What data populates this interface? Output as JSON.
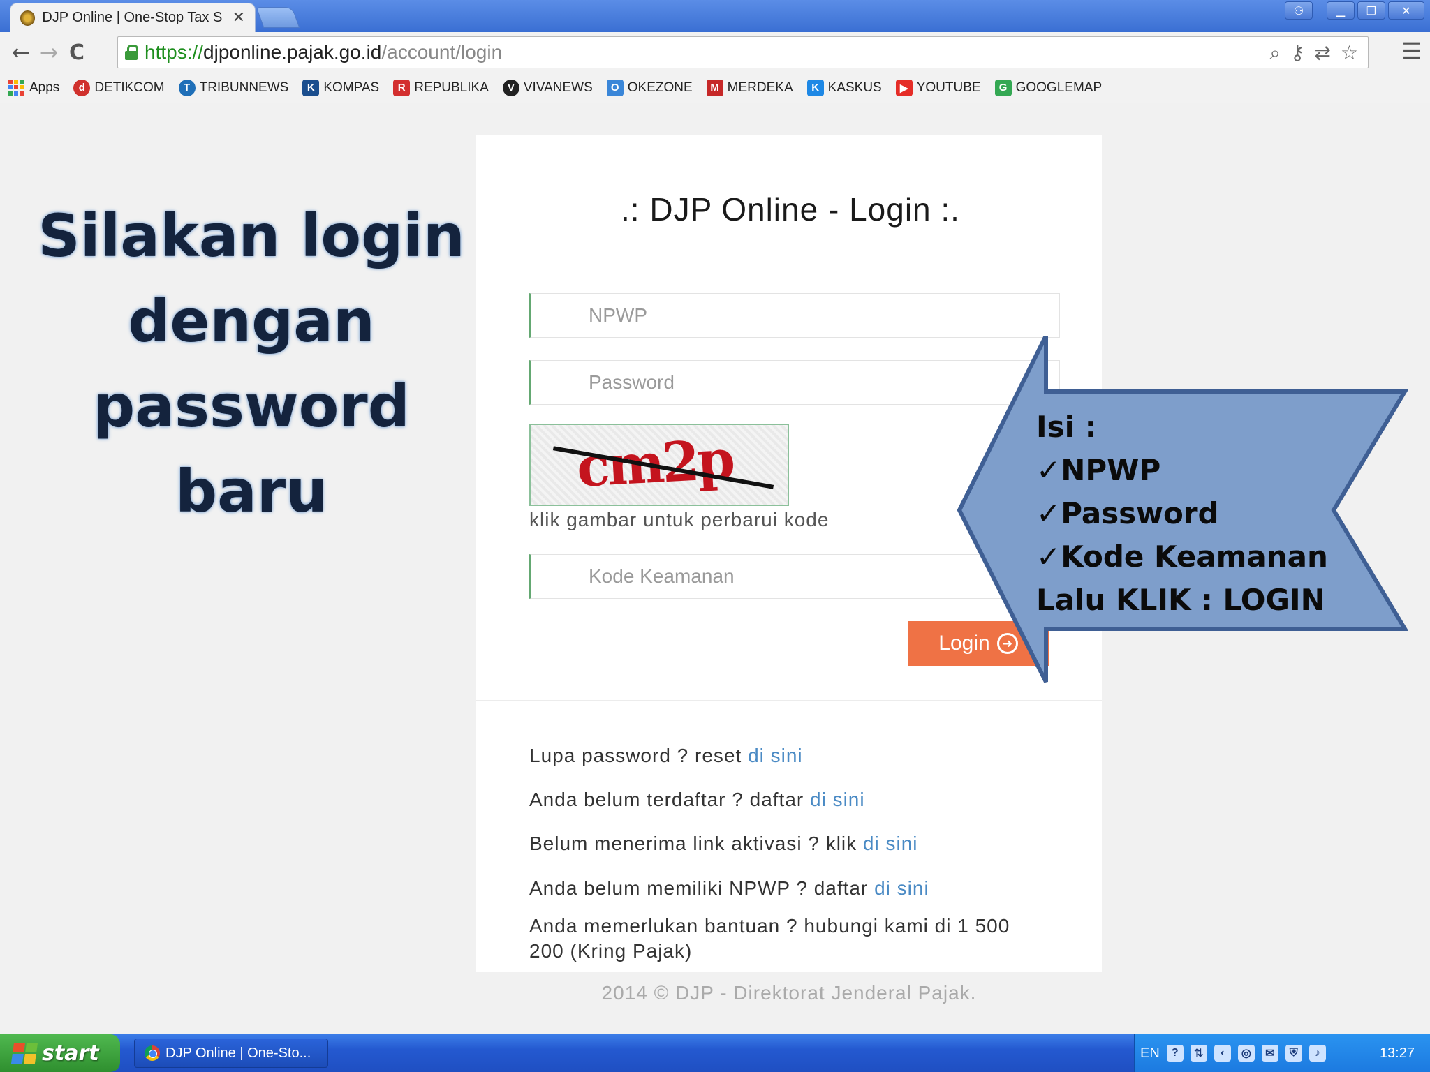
{
  "browser": {
    "tab_title": "DJP Online | One-Stop Tax S",
    "tab_close": "✕",
    "url_proto": "https://",
    "url_host": "djponline.pajak.go.id",
    "url_path": "/account/login",
    "nav_back": "←",
    "nav_forward": "→",
    "nav_reload": "C",
    "menu": "☰",
    "window_buttons": {
      "user": "⚇",
      "minimize": "▁",
      "restore": "❐",
      "close": "✕"
    }
  },
  "bookmarks": [
    {
      "label": "Apps",
      "color": "#e94235"
    },
    {
      "label": "DETIKCOM",
      "color": "#d0312d",
      "glyph": "d"
    },
    {
      "label": "TRIBUNNEWS",
      "color": "#1f6fb8",
      "glyph": "T"
    },
    {
      "label": "KOMPAS",
      "color": "#1b4e8e",
      "glyph": "K"
    },
    {
      "label": "REPUBLIKA",
      "color": "#d32f2f",
      "glyph": "R"
    },
    {
      "label": "VIVANEWS",
      "color": "#222222",
      "glyph": "V"
    },
    {
      "label": "OKEZONE",
      "color": "#3a86d8",
      "glyph": "O"
    },
    {
      "label": "MERDEKA",
      "color": "#c62828",
      "glyph": "M"
    },
    {
      "label": "KASKUS",
      "color": "#1e88e5",
      "glyph": "K"
    },
    {
      "label": "YOUTUBE",
      "color": "#e52d27",
      "glyph": "▶"
    },
    {
      "label": "GOOGLEMAP",
      "color": "#34a853",
      "glyph": "G"
    }
  ],
  "headline": {
    "line1": "Silakan login",
    "line2": "dengan",
    "line3": "password baru"
  },
  "login": {
    "title": ".: DJP Online - Login :.",
    "npwp_placeholder": "NPWP",
    "password_placeholder": "Password",
    "captcha_text": "cm2p",
    "captcha_hint": "klik gambar untuk perbarui kode",
    "security_code_placeholder": "Kode Keamanan",
    "login_button": "Login",
    "login_arrow": "➜"
  },
  "links": [
    {
      "text": "Lupa password ? reset ",
      "link": "di sini"
    },
    {
      "text": "Anda belum terdaftar ? daftar ",
      "link": "di sini"
    },
    {
      "text": "Belum menerima link aktivasi ? klik ",
      "link": "di sini"
    },
    {
      "text": "Anda belum memiliki NPWP ? daftar ",
      "link": "di sini"
    }
  ],
  "help_text": "Anda memerlukan bantuan ? hubungi kami di 1 500 200 (Kring Pajak)",
  "footer": "2014 © DJP - Direktorat Jenderal Pajak.",
  "callout": {
    "line1": "Isi :",
    "line2": "✓NPWP",
    "line3": "✓Password",
    "line4": "✓Kode Keamanan",
    "line5": "Lalu KLIK : LOGIN",
    "fill": "#7e9ecb",
    "stroke": "#3f5f94"
  },
  "taskbar": {
    "start_label": "start",
    "task_label": "DJP Online | One-Sto...",
    "lang": "EN",
    "clock": "13:27"
  }
}
